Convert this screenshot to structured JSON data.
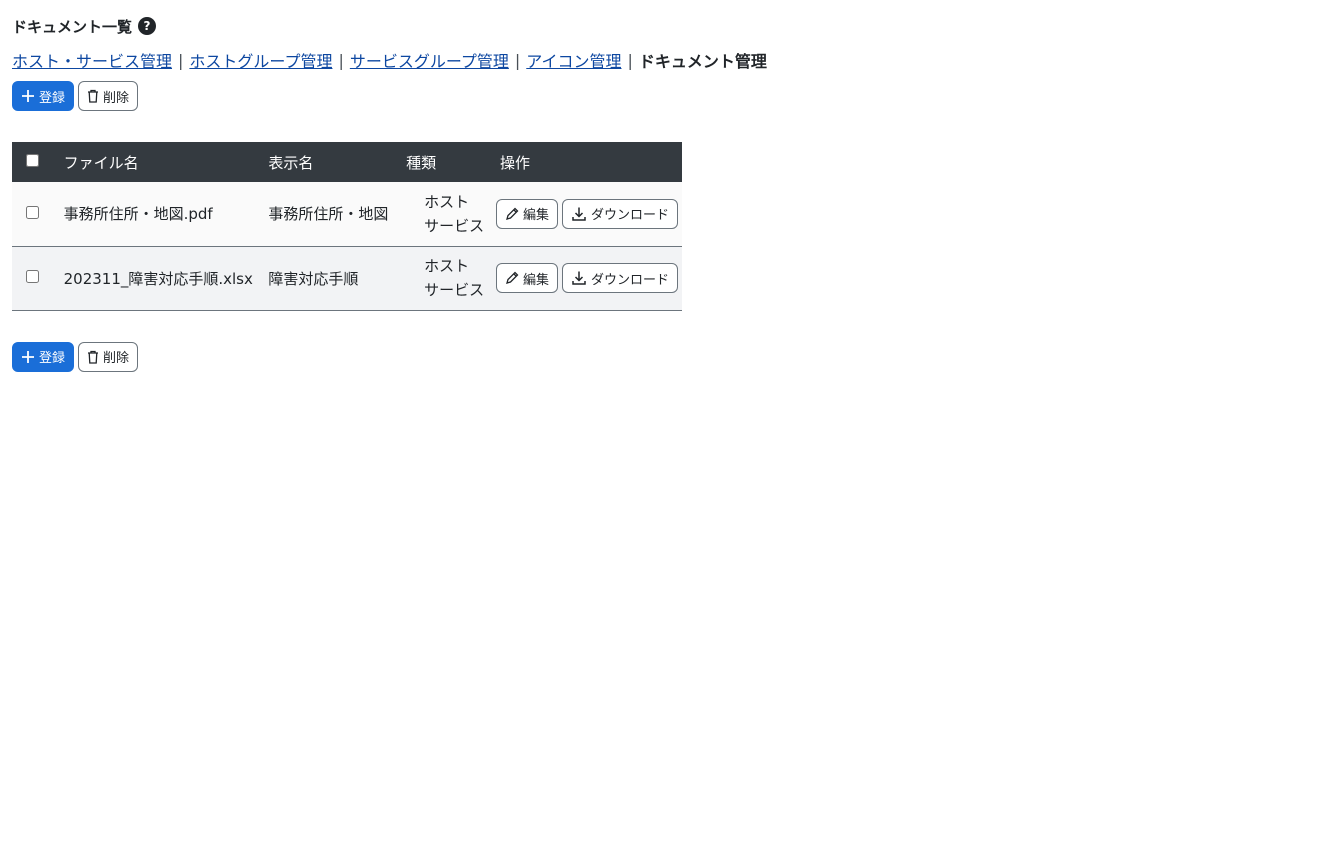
{
  "page": {
    "title": "ドキュメント一覧",
    "help_icon": "?"
  },
  "nav": {
    "links": [
      "ホスト・サービス管理",
      "ホストグループ管理",
      "サービスグループ管理",
      "アイコン管理"
    ],
    "separator": "|",
    "current": "ドキュメント管理"
  },
  "toolbar": {
    "register_label": "登録",
    "delete_label": "削除"
  },
  "table": {
    "headers": {
      "file_name": "ファイル名",
      "display_name": "表示名",
      "kind": "種類",
      "ops": "操作"
    },
    "rows": [
      {
        "file_name": "事務所住所・地図.pdf",
        "display_name": "事務所住所・地図",
        "kind_line1": "ホスト",
        "kind_line2": "サービス",
        "edit_label": "編集",
        "download_label": "ダウンロード"
      },
      {
        "file_name": "202311_障害対応手順.xlsx",
        "display_name": "障害対応手順",
        "kind_line1": "ホスト",
        "kind_line2": "サービス",
        "edit_label": "編集",
        "download_label": "ダウンロード"
      }
    ]
  },
  "colors": {
    "primary": "#1a6ed8",
    "header_bg": "#343a40",
    "link": "#0d47a1"
  }
}
